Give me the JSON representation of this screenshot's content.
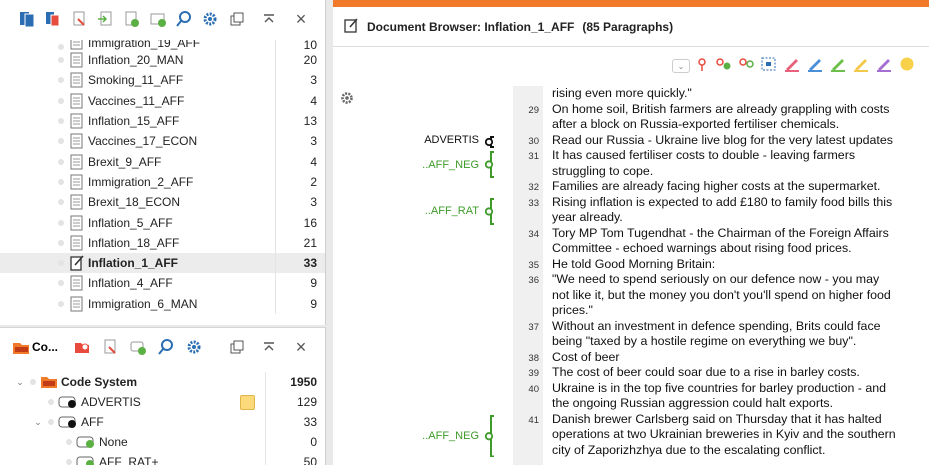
{
  "docs_toolbar": {
    "icons": [
      "documents-icon",
      "document-group-icon",
      "activate-documents-icon",
      "import-icon",
      "new-document-icon",
      "new-document-set-icon",
      "search-icon",
      "settings-icon",
      "undock-icon",
      "collapse-icon",
      "close-icon"
    ],
    "close": "×"
  },
  "documents": [
    {
      "name": "Immigration_19_AFF",
      "count": "10",
      "partial": true
    },
    {
      "name": "Inflation_20_MAN",
      "count": "20"
    },
    {
      "name": "Smoking_11_AFF",
      "count": "3"
    },
    {
      "name": "Vaccines_11_AFF",
      "count": "4"
    },
    {
      "name": "Inflation_15_AFF",
      "count": "13"
    },
    {
      "name": "Vaccines_17_ECON",
      "count": "3"
    },
    {
      "name": "Brexit_9_AFF",
      "count": "4"
    },
    {
      "name": "Immigration_2_AFF",
      "count": "2"
    },
    {
      "name": "Brexit_18_ECON",
      "count": "3"
    },
    {
      "name": "Inflation_5_AFF",
      "count": "16"
    },
    {
      "name": "Inflation_18_AFF",
      "count": "21"
    },
    {
      "name": "Inflation_1_AFF",
      "count": "33",
      "selected": true
    },
    {
      "name": "Inflation_4_AFF",
      "count": "9"
    },
    {
      "name": "Immigration_6_MAN",
      "count": "9"
    }
  ],
  "code_toolbar": {
    "label": "Co...",
    "close": "×"
  },
  "codes": [
    {
      "name": "Code System",
      "count": "1950",
      "level": 0,
      "bold": true,
      "chevron": "⌄"
    },
    {
      "name": "ADVERTIS",
      "count": "129",
      "level": 1,
      "memo": true
    },
    {
      "name": "AFF",
      "count": "33",
      "level": 1,
      "chevron": "⌄"
    },
    {
      "name": "None",
      "count": "0",
      "level": 2
    },
    {
      "name": "AFF_RAT+",
      "count": "50",
      "level": 2
    }
  ],
  "browser": {
    "title": "Document Browser: Inflation_1_AFF",
    "paragraphs": "(85 Paragraphs)",
    "accent": "#f07a2a"
  },
  "paragraph_numbers": [
    {
      "n": "29",
      "row": 1
    },
    {
      "n": "30",
      "row": 3
    },
    {
      "n": "31",
      "row": 4
    },
    {
      "n": "32",
      "row": 6
    },
    {
      "n": "33",
      "row": 7
    },
    {
      "n": "34",
      "row": 9
    },
    {
      "n": "35",
      "row": 11
    },
    {
      "n": "36",
      "row": 12
    },
    {
      "n": "37",
      "row": 15
    },
    {
      "n": "38",
      "row": 17
    },
    {
      "n": "39",
      "row": 18
    },
    {
      "n": "40",
      "row": 19
    },
    {
      "n": "41",
      "row": 21
    }
  ],
  "text_lines": [
    "rising even more quickly.\"",
    "On home soil, British farmers are already grappling with costs",
    "after a block on Russia-exported fertiliser chemicals.",
    "Read our Russia - Ukraine live blog for the very latest updates",
    "It has caused fertiliser costs to double - leaving farmers",
    "struggling to cope.",
    "Families are already facing higher costs at the supermarket.",
    "Rising inflation is expected to add £180 to family food bills this",
    "year already.",
    "Tory MP Tom Tugendhat - the Chairman of the Foreign Affairs",
    "Committee - echoed warnings about rising food prices.",
    "He told Good Morning Britain:",
    "\"We need to spend seriously on our defence now - you may",
    "not like it, but the money you don't you'll spend on higher food",
    "prices.\"",
    "Without an investment in defence spending, Brits could face",
    "being \"taxed by a hostile regime on everything we buy\".",
    "Cost of beer",
    "The cost of beer could soar due to a rise in barley costs.",
    "Ukraine is in the top five countries for barley production - and",
    "the ongoing Russian aggression could halt exports.",
    "Danish brewer Carlsberg said on Thursday that it has halted",
    "operations at two Ukrainian breweries in Kyiv and the southern",
    "city of Zaporizhzhya due to the escalating conflict."
  ],
  "code_stripes": [
    {
      "label": "ADVERTIS",
      "color": "#111111",
      "row": 3,
      "span": 1
    },
    {
      "label": "..AFF_NEG",
      "color": "#3e9b2a",
      "row": 4,
      "span": 2
    },
    {
      "label": "..AFF_RAT",
      "color": "#3e9b2a",
      "row": 7,
      "span": 2
    },
    {
      "label": "..AFF_NEG",
      "color": "#3e9b2a",
      "row": 21,
      "span": 3
    }
  ],
  "colors": {
    "green": "#3e9b2a",
    "orange": "#f07a2a",
    "memo": "#fcd97a"
  }
}
